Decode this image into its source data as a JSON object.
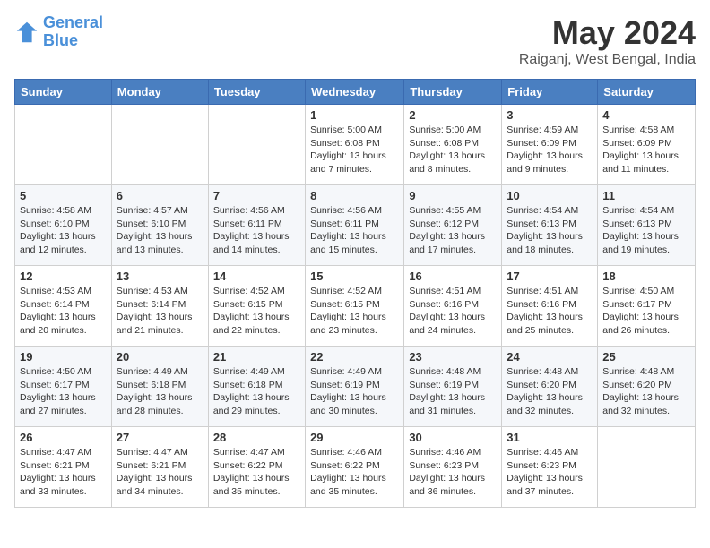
{
  "header": {
    "logo_line1": "General",
    "logo_line2": "Blue",
    "month": "May 2024",
    "location": "Raiganj, West Bengal, India"
  },
  "days_of_week": [
    "Sunday",
    "Monday",
    "Tuesday",
    "Wednesday",
    "Thursday",
    "Friday",
    "Saturday"
  ],
  "weeks": [
    [
      {
        "day": "",
        "content": ""
      },
      {
        "day": "",
        "content": ""
      },
      {
        "day": "",
        "content": ""
      },
      {
        "day": "1",
        "content": "Sunrise: 5:00 AM\nSunset: 6:08 PM\nDaylight: 13 hours\nand 7 minutes."
      },
      {
        "day": "2",
        "content": "Sunrise: 5:00 AM\nSunset: 6:08 PM\nDaylight: 13 hours\nand 8 minutes."
      },
      {
        "day": "3",
        "content": "Sunrise: 4:59 AM\nSunset: 6:09 PM\nDaylight: 13 hours\nand 9 minutes."
      },
      {
        "day": "4",
        "content": "Sunrise: 4:58 AM\nSunset: 6:09 PM\nDaylight: 13 hours\nand 11 minutes."
      }
    ],
    [
      {
        "day": "5",
        "content": "Sunrise: 4:58 AM\nSunset: 6:10 PM\nDaylight: 13 hours\nand 12 minutes."
      },
      {
        "day": "6",
        "content": "Sunrise: 4:57 AM\nSunset: 6:10 PM\nDaylight: 13 hours\nand 13 minutes."
      },
      {
        "day": "7",
        "content": "Sunrise: 4:56 AM\nSunset: 6:11 PM\nDaylight: 13 hours\nand 14 minutes."
      },
      {
        "day": "8",
        "content": "Sunrise: 4:56 AM\nSunset: 6:11 PM\nDaylight: 13 hours\nand 15 minutes."
      },
      {
        "day": "9",
        "content": "Sunrise: 4:55 AM\nSunset: 6:12 PM\nDaylight: 13 hours\nand 17 minutes."
      },
      {
        "day": "10",
        "content": "Sunrise: 4:54 AM\nSunset: 6:13 PM\nDaylight: 13 hours\nand 18 minutes."
      },
      {
        "day": "11",
        "content": "Sunrise: 4:54 AM\nSunset: 6:13 PM\nDaylight: 13 hours\nand 19 minutes."
      }
    ],
    [
      {
        "day": "12",
        "content": "Sunrise: 4:53 AM\nSunset: 6:14 PM\nDaylight: 13 hours\nand 20 minutes."
      },
      {
        "day": "13",
        "content": "Sunrise: 4:53 AM\nSunset: 6:14 PM\nDaylight: 13 hours\nand 21 minutes."
      },
      {
        "day": "14",
        "content": "Sunrise: 4:52 AM\nSunset: 6:15 PM\nDaylight: 13 hours\nand 22 minutes."
      },
      {
        "day": "15",
        "content": "Sunrise: 4:52 AM\nSunset: 6:15 PM\nDaylight: 13 hours\nand 23 minutes."
      },
      {
        "day": "16",
        "content": "Sunrise: 4:51 AM\nSunset: 6:16 PM\nDaylight: 13 hours\nand 24 minutes."
      },
      {
        "day": "17",
        "content": "Sunrise: 4:51 AM\nSunset: 6:16 PM\nDaylight: 13 hours\nand 25 minutes."
      },
      {
        "day": "18",
        "content": "Sunrise: 4:50 AM\nSunset: 6:17 PM\nDaylight: 13 hours\nand 26 minutes."
      }
    ],
    [
      {
        "day": "19",
        "content": "Sunrise: 4:50 AM\nSunset: 6:17 PM\nDaylight: 13 hours\nand 27 minutes."
      },
      {
        "day": "20",
        "content": "Sunrise: 4:49 AM\nSunset: 6:18 PM\nDaylight: 13 hours\nand 28 minutes."
      },
      {
        "day": "21",
        "content": "Sunrise: 4:49 AM\nSunset: 6:18 PM\nDaylight: 13 hours\nand 29 minutes."
      },
      {
        "day": "22",
        "content": "Sunrise: 4:49 AM\nSunset: 6:19 PM\nDaylight: 13 hours\nand 30 minutes."
      },
      {
        "day": "23",
        "content": "Sunrise: 4:48 AM\nSunset: 6:19 PM\nDaylight: 13 hours\nand 31 minutes."
      },
      {
        "day": "24",
        "content": "Sunrise: 4:48 AM\nSunset: 6:20 PM\nDaylight: 13 hours\nand 32 minutes."
      },
      {
        "day": "25",
        "content": "Sunrise: 4:48 AM\nSunset: 6:20 PM\nDaylight: 13 hours\nand 32 minutes."
      }
    ],
    [
      {
        "day": "26",
        "content": "Sunrise: 4:47 AM\nSunset: 6:21 PM\nDaylight: 13 hours\nand 33 minutes."
      },
      {
        "day": "27",
        "content": "Sunrise: 4:47 AM\nSunset: 6:21 PM\nDaylight: 13 hours\nand 34 minutes."
      },
      {
        "day": "28",
        "content": "Sunrise: 4:47 AM\nSunset: 6:22 PM\nDaylight: 13 hours\nand 35 minutes."
      },
      {
        "day": "29",
        "content": "Sunrise: 4:46 AM\nSunset: 6:22 PM\nDaylight: 13 hours\nand 35 minutes."
      },
      {
        "day": "30",
        "content": "Sunrise: 4:46 AM\nSunset: 6:23 PM\nDaylight: 13 hours\nand 36 minutes."
      },
      {
        "day": "31",
        "content": "Sunrise: 4:46 AM\nSunset: 6:23 PM\nDaylight: 13 hours\nand 37 minutes."
      },
      {
        "day": "",
        "content": ""
      }
    ]
  ]
}
